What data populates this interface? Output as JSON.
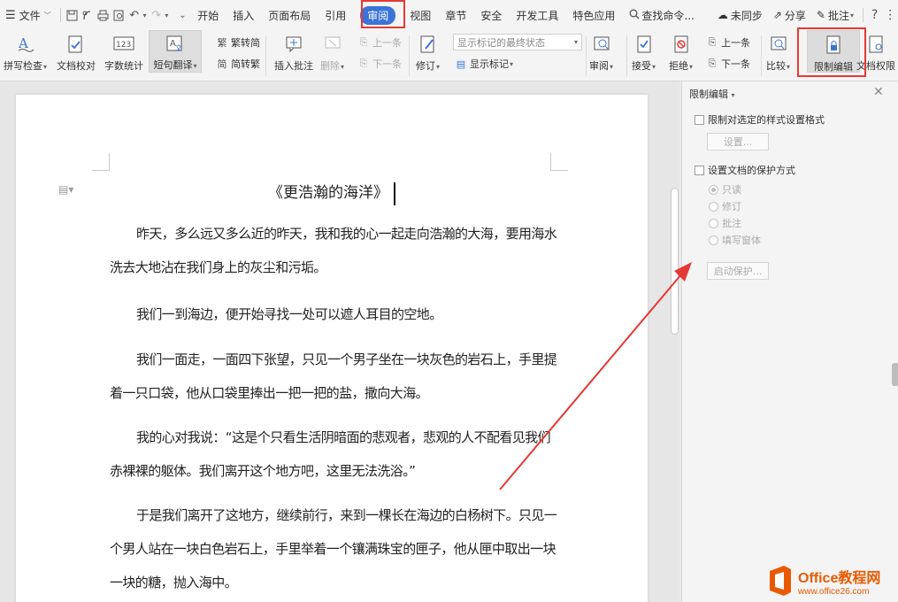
{
  "menubar": {
    "file_label": "文件",
    "tabs": [
      "开始",
      "插入",
      "页面布局",
      "引用",
      "审阅",
      "视图",
      "章节",
      "安全",
      "开发工具",
      "特色应用"
    ],
    "active_tab": "审阅",
    "search_placeholder": "查找命令...",
    "sync_label": "未同步",
    "share_label": "分享",
    "comment_label": "批注"
  },
  "ribbon": {
    "spell_check": "拼写检查",
    "doc_proof": "文档校对",
    "word_count": "字数统计",
    "short_translate": "短句翻译",
    "trad_conv": "繁转简",
    "simp_conv": "简转繁",
    "insert_comment": "插入批注",
    "delete": "删除",
    "prev_item": "上一条",
    "next_item": "下一条",
    "revise": "修订",
    "display_select": "显示标记的最终状态",
    "show_markup": "显示标记",
    "review": "审阅",
    "accept": "接受",
    "reject": "拒绝",
    "prev_change": "上一条",
    "next_change": "下一条",
    "compare": "比较",
    "restrict_edit": "限制编辑",
    "doc_rights": "文档权限"
  },
  "document": {
    "title": "《更浩瀚的海洋》",
    "paragraphs": [
      "昨天，多么远又多么近的昨天，我和我的心一起走向浩瀚的大海，要用海水洗去大地沾在我们身上的灰尘和污垢。",
      "我们一到海边，便开始寻找一处可以遮人耳目的空地。",
      "我们一面走，一面四下张望，只见一个男子坐在一块灰色的岩石上，手里提着一只口袋，他从口袋里捧出一把一把的盐，撒向大海。",
      "我的心对我说：“这是个只看生活阴暗面的悲观者，悲观的人不配看见我们赤裸裸的躯体。我们离开这个地方吧，这里无法洗浴。”",
      "于是我们离开了这地方，继续前行，来到一棵长在海边的白杨树下。只见一个男人站在一块白色岩石上，手里举着一个镶满珠宝的匣子，他从匣中取出一块一块的糖，抛入海中。"
    ]
  },
  "panel": {
    "title": "限制编辑",
    "opt_format": "限制对选定的样式设置格式",
    "settings_btn": "设置...",
    "opt_protect": "设置文档的保护方式",
    "radio_readonly": "只读",
    "radio_revise": "修订",
    "radio_comment": "批注",
    "radio_form": "填写窗体",
    "start_btn": "启动保护..."
  },
  "watermark": {
    "brand": "Office教程网",
    "url": "www.office26.com"
  },
  "colors": {
    "accent": "#3b73d8",
    "highlight": "#e53935",
    "watermark": "#e85a00"
  }
}
